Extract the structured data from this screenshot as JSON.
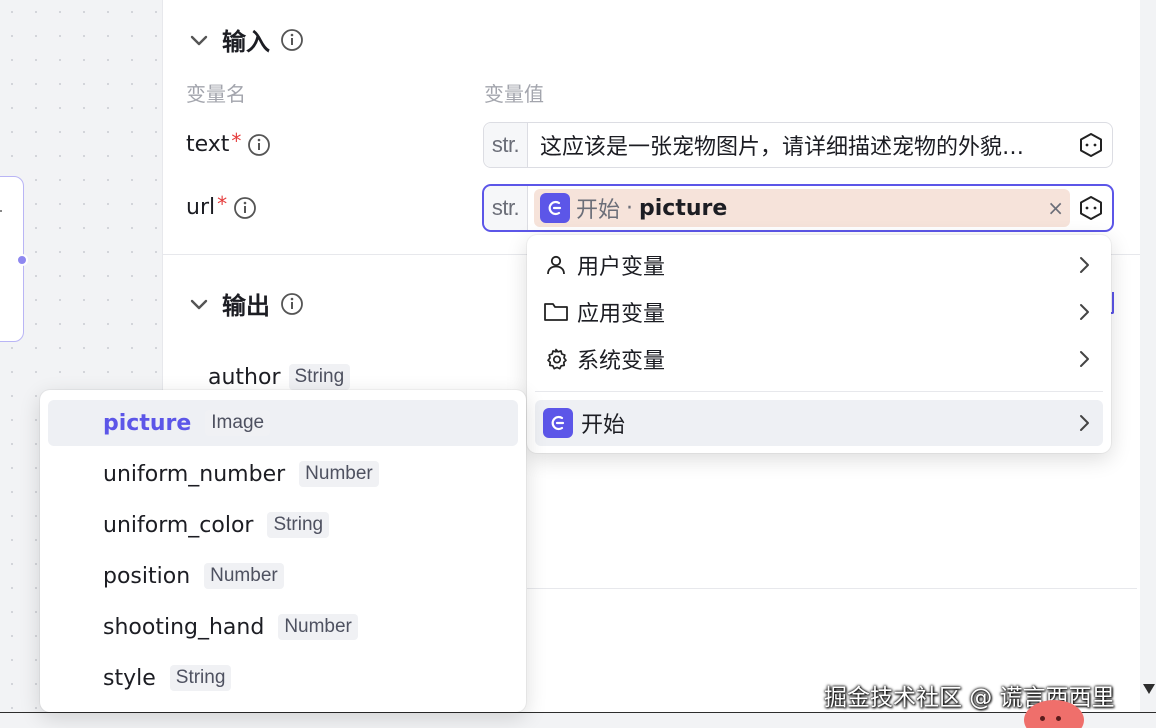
{
  "input_section": {
    "title": "输入"
  },
  "columns": {
    "var_name": "变量名",
    "var_value": "变量值"
  },
  "inputs": [
    {
      "name": "text",
      "required": "*",
      "type": "str.",
      "value": "这应该是一张宠物图片，请详细描述宠物的外貌…"
    },
    {
      "name": "url",
      "required": "*",
      "type": "str.",
      "chip_source": "开始",
      "chip_dot": "·",
      "chip_var": "picture",
      "chip_close": "×"
    }
  ],
  "output_section": {
    "title": "输出",
    "rows": [
      {
        "name": "author",
        "type": "String"
      }
    ]
  },
  "variable_menu": {
    "items": [
      {
        "label": "用户变量",
        "icon": "user-icon"
      },
      {
        "label": "应用变量",
        "icon": "folder-icon"
      },
      {
        "label": "系统变量",
        "icon": "gear-icon"
      },
      {
        "label": "开始",
        "icon": "start-node-icon"
      }
    ]
  },
  "start_fields": [
    {
      "name": "picture",
      "type": "Image"
    },
    {
      "name": "uniform_number",
      "type": "Number"
    },
    {
      "name": "uniform_color",
      "type": "String"
    },
    {
      "name": "position",
      "type": "Number"
    },
    {
      "name": "shooting_hand",
      "type": "Number"
    },
    {
      "name": "style",
      "type": "String"
    }
  ],
  "watermark": "掘金技术社区 @ 谎言西西里",
  "colors": {
    "accent": "#5c56e8",
    "chip_bg": "#f6e3da",
    "required": "#e53b3b"
  }
}
